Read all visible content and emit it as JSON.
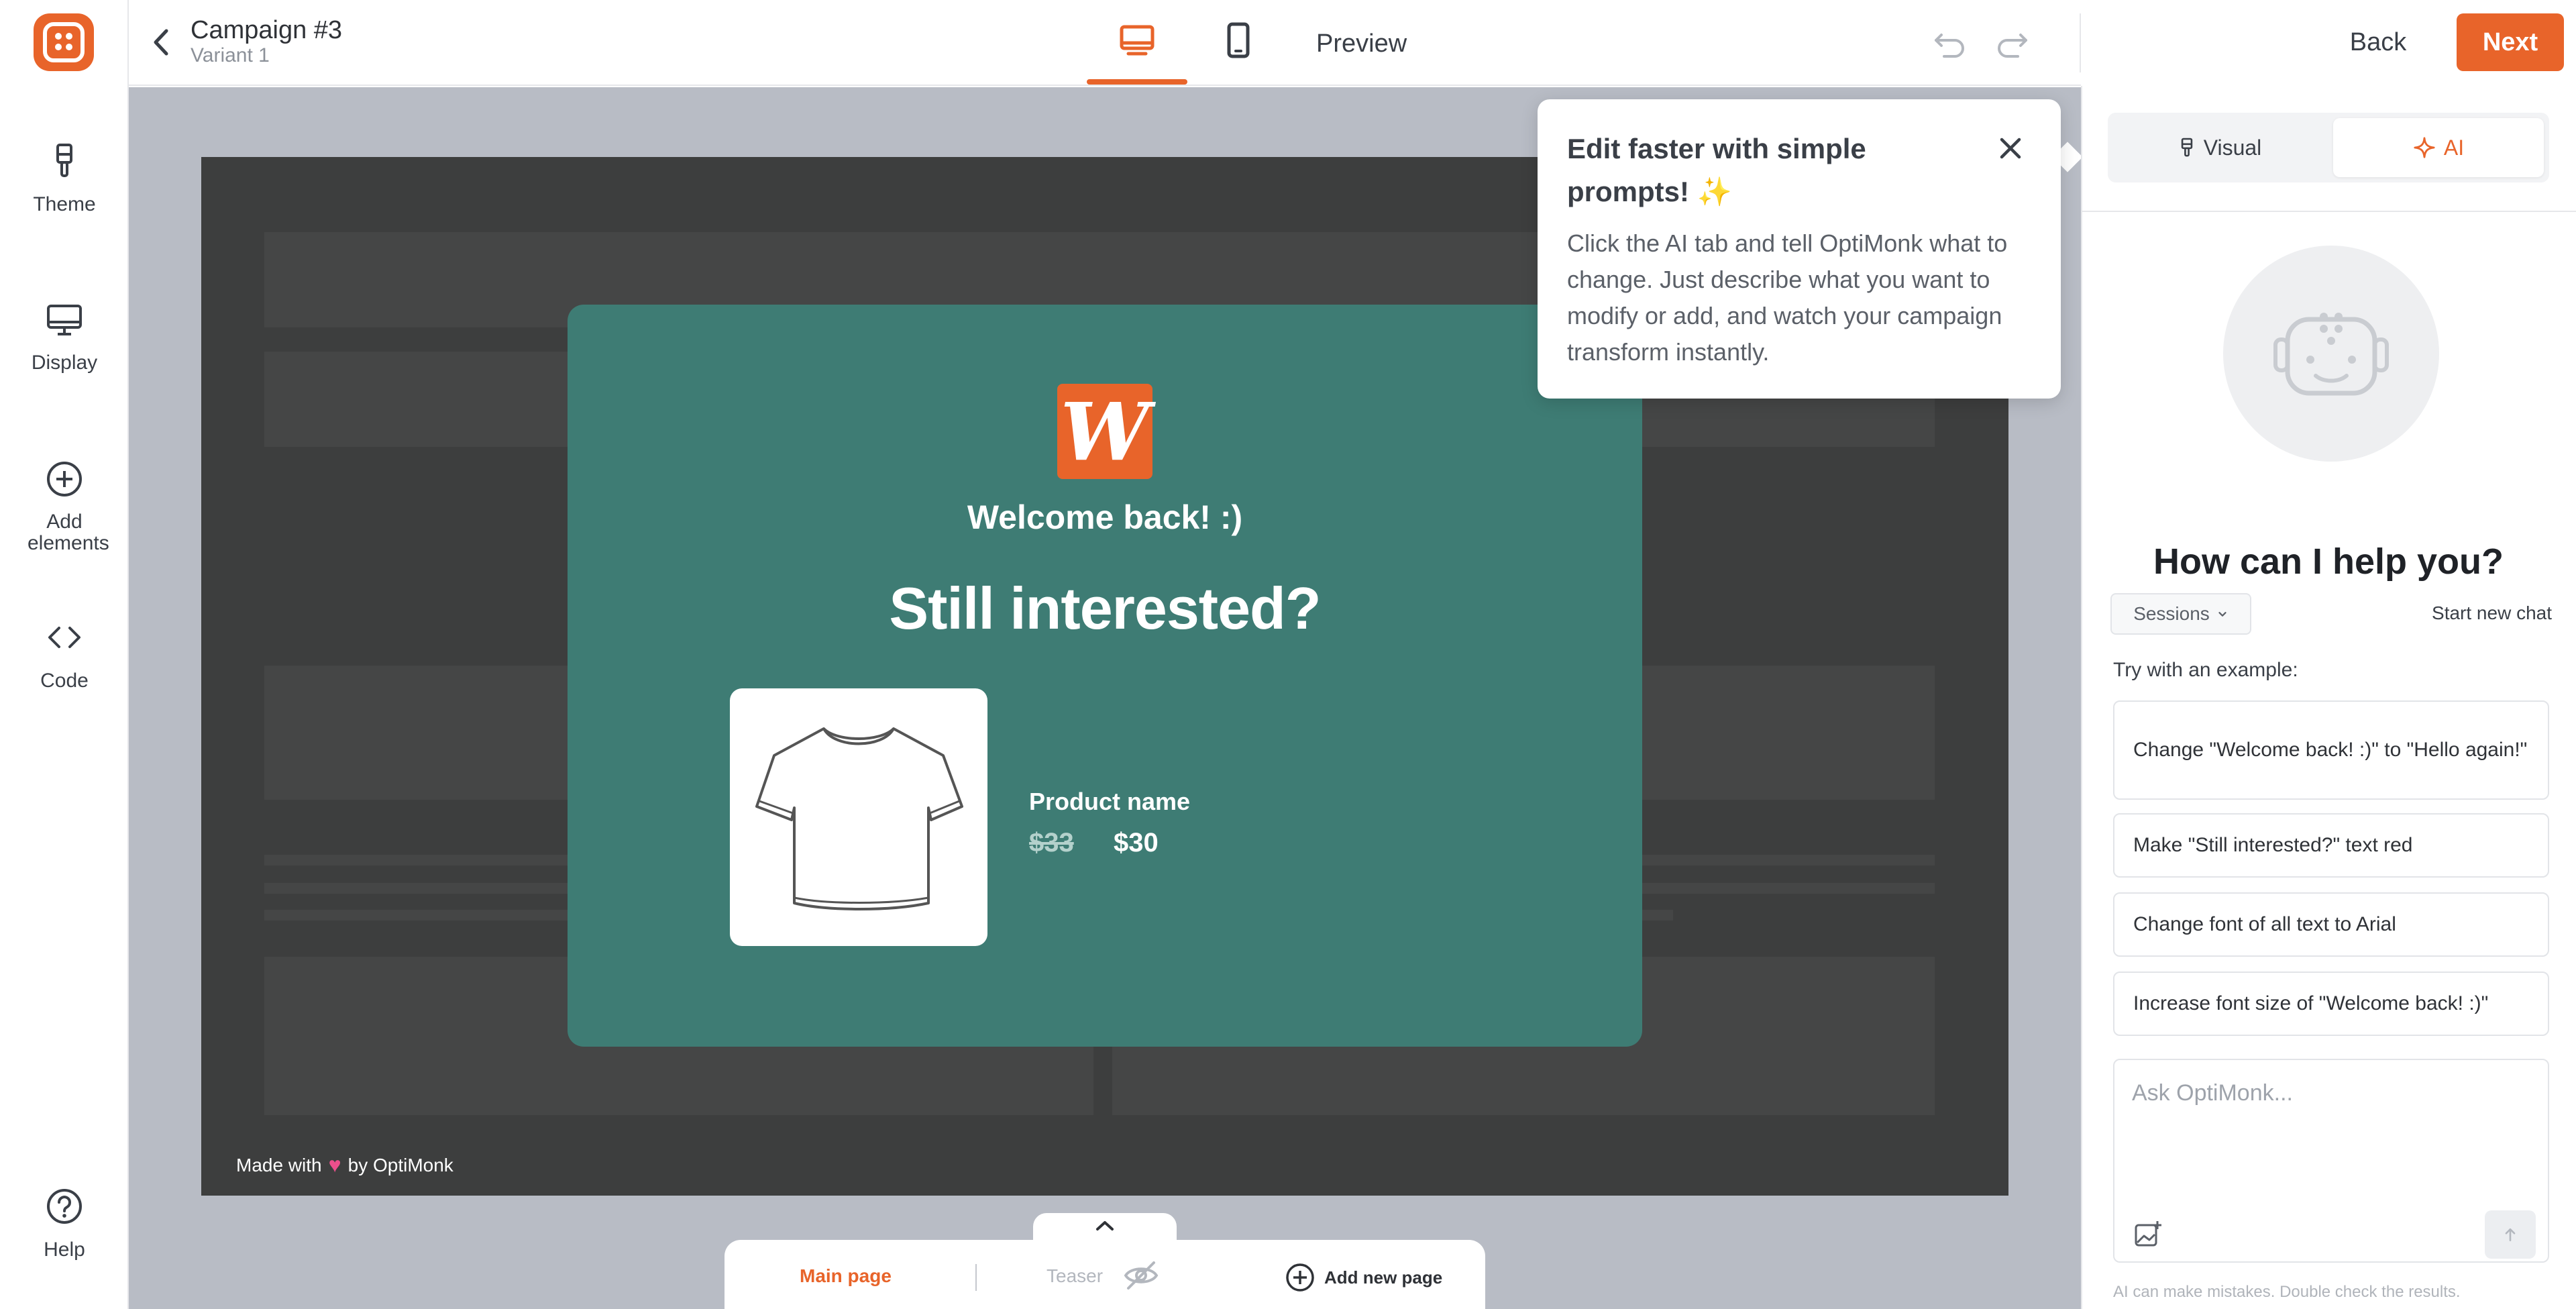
{
  "app": {
    "brand_color": "#e8642a",
    "campaign_title": "Campaign #3",
    "variant": "Variant 1"
  },
  "sidebar": {
    "items": [
      {
        "label": "Theme",
        "icon": "brush-icon"
      },
      {
        "label": "Display",
        "icon": "monitor-icon"
      },
      {
        "label": "Add elements",
        "icon": "plus-circle-icon"
      },
      {
        "label": "Code",
        "icon": "code-icon"
      }
    ],
    "help_label": "Help"
  },
  "topbar": {
    "preview_label": "Preview",
    "back_label": "Back",
    "next_label": "Next"
  },
  "popup": {
    "logo_letter": "W",
    "welcome": "Welcome back! :)",
    "headline": "Still interested?",
    "product_name": "Product name",
    "price_old": "$33",
    "price_new": "$30",
    "background_color": "#3e7c74"
  },
  "canvas": {
    "made_with_prefix": "Made with",
    "made_with_suffix": "by OptiMonk"
  },
  "pages": {
    "main": "Main page",
    "teaser": "Teaser",
    "add_new": "Add new page"
  },
  "tooltip": {
    "title": "Edit faster with simple prompts! ✨",
    "body": "Click the AI tab and tell OptiMonk what to change. Just describe what you want to modify or add, and watch your campaign transform instantly."
  },
  "right_panel": {
    "mode_visual": "Visual",
    "mode_ai": "AI",
    "heading": "How can I help you?",
    "sessions_label": "Sessions",
    "new_chat_label": "Start new chat",
    "try_example_label": "Try with an example:",
    "examples": [
      "Change \"Welcome back! :)\" to \"Hello again!\"",
      "Make \"Still interested?\" text red",
      "Change font of all text to Arial",
      "Increase font size of \"Welcome back! :)\""
    ],
    "ask_placeholder": "Ask OptiMonk...",
    "ask_value": "",
    "disclaimer": "AI can make mistakes. Double check the results."
  }
}
